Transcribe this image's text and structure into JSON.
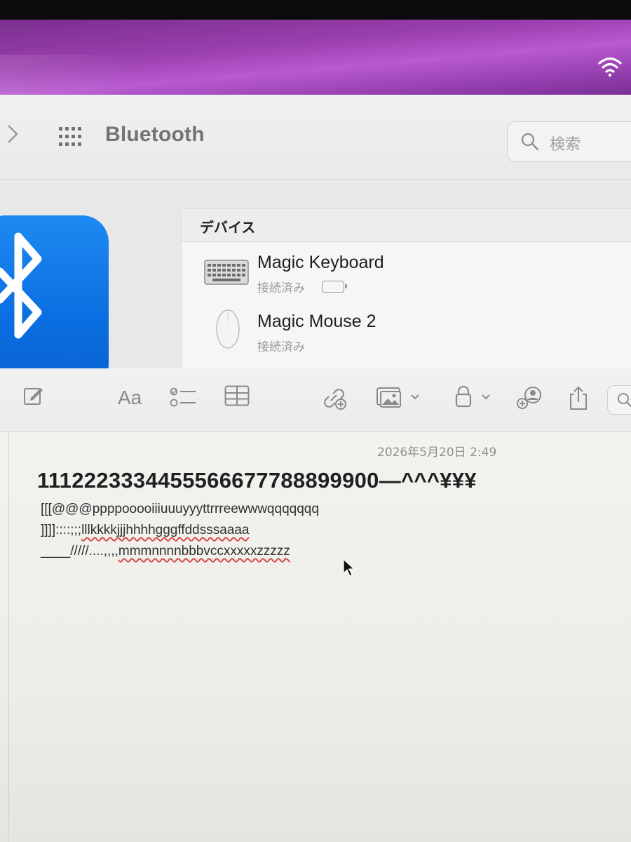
{
  "settings": {
    "title": "Bluetooth",
    "search_placeholder": "検索",
    "devices_header": "デバイス",
    "devices": [
      {
        "name": "Magic Keyboard",
        "status": "接続済み",
        "icon": "keyboard-icon",
        "battery_shown": true
      },
      {
        "name": "Magic Mouse 2",
        "status": "接続済み",
        "icon": "mouse-icon",
        "battery_shown": false
      }
    ],
    "accent": "#1a7ff0"
  },
  "notes": {
    "toolbar": {
      "format_label": "Aa"
    },
    "date": "2026年5月20日 2:49",
    "lines": {
      "l1": "1112223334455566677788899900—^^^¥¥¥",
      "l2": "[[[@@@ppppooooiiiuuuyyyttrrreewwwqqqqqqq",
      "l3a": "]]]]::::;;;",
      "l3b": "lllkkkkjjjhhhhgggffddsssaaaa",
      "l4a": "____/////....,,,,",
      "l4b": "mmmnnnnbbbvccxxxxxzzzzz"
    }
  },
  "icons": {
    "wifi": "wifi-icon",
    "search": "search-icon",
    "bluetooth": "bluetooth-icon"
  }
}
